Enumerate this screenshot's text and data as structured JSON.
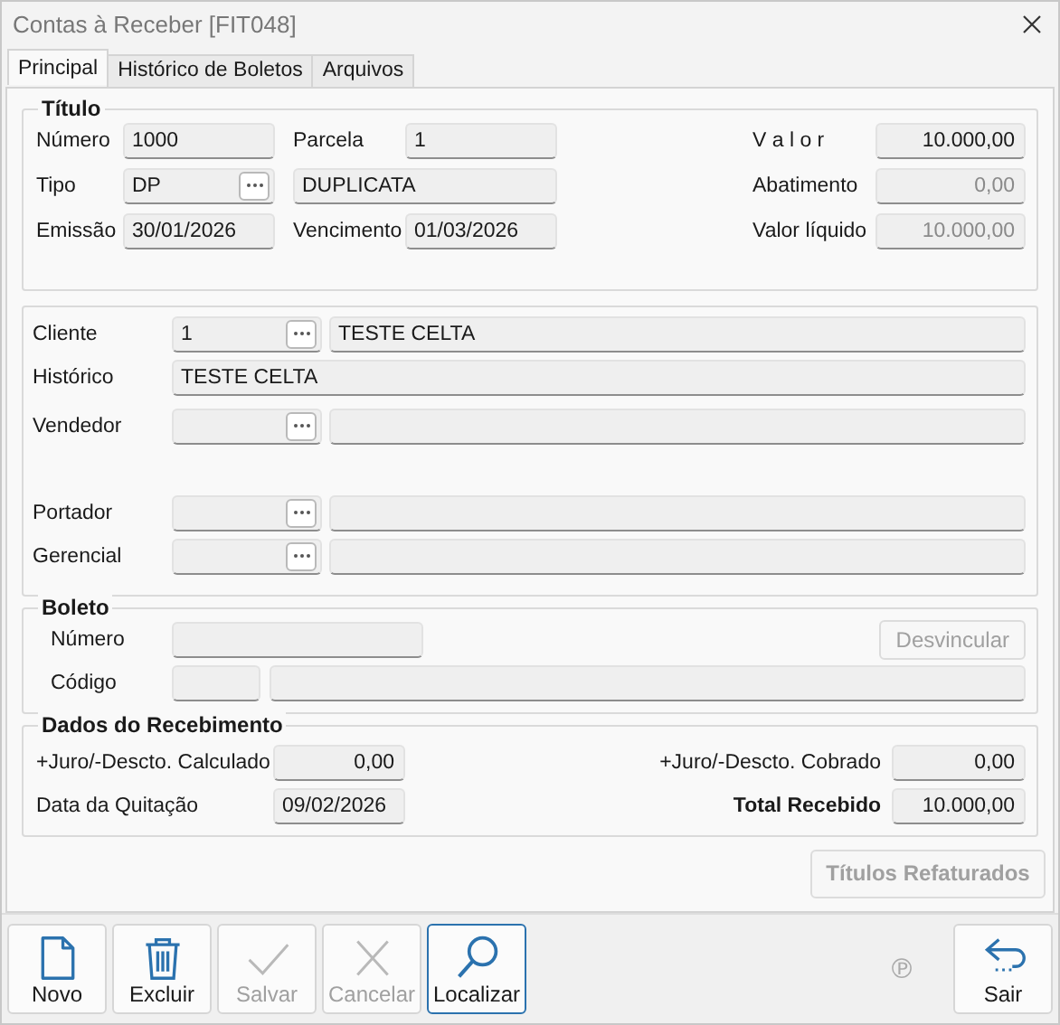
{
  "window": {
    "title": "Contas à Receber [FIT048]"
  },
  "tabs": [
    {
      "label": "Principal",
      "selected": true
    },
    {
      "label": "Histórico de Boletos",
      "selected": false
    },
    {
      "label": "Arquivos",
      "selected": false
    }
  ],
  "titulo": {
    "legend": "Título",
    "rows": [
      {
        "left": {
          "label": "Número",
          "value": "1000",
          "lookup": false
        },
        "mid": {
          "label": "Parcela",
          "value": "1"
        },
        "right": {
          "label": "V a l o r",
          "value": "10.000,00",
          "disabled": false
        }
      },
      {
        "left": {
          "label": "Tipo",
          "value": "DP",
          "lookup": true
        },
        "mid": {
          "value": "DUPLICATA"
        },
        "right": {
          "label": "Abatimento",
          "value": "0,00",
          "disabled": true
        }
      },
      {
        "left": {
          "label": "Emissão",
          "value": "30/01/2026",
          "lookup": false
        },
        "mid": {
          "label": "Vencimento",
          "value": "01/03/2026"
        },
        "right": {
          "label": "Valor líquido",
          "value": "10.000,00",
          "disabled": true
        }
      }
    ]
  },
  "cliente": {
    "rows": [
      {
        "kind": "lookup",
        "label": "Cliente",
        "code": "1",
        "description": "TESTE CELTA"
      },
      {
        "kind": "text",
        "label": "Histórico",
        "value": "TESTE CELTA"
      },
      {
        "kind": "lookup",
        "label": "Vendedor"
      },
      {
        "kind": "lookup",
        "label": "Portador"
      },
      {
        "kind": "lookup",
        "label": "Gerencial"
      }
    ]
  },
  "boleto": {
    "legend": "Boleto",
    "numero_label": "Número",
    "codigo_label": "Código",
    "unlink_button": {
      "label": "Desvincular",
      "disabled": true
    }
  },
  "recebimento": {
    "legend": "Dados do Recebimento",
    "rows": [
      {
        "left": {
          "label": "+Juro/-Descto. Calculado",
          "value": "0,00",
          "kind": "amount"
        },
        "right": {
          "label": "+Juro/-Descto. Cobrado",
          "value": "0,00",
          "bold": false
        }
      },
      {
        "left": {
          "label": "Data da Quitação",
          "value": "09/02/2026",
          "kind": "date"
        },
        "right": {
          "label": "Total Recebido",
          "value": "10.000,00",
          "bold": true
        }
      }
    ]
  },
  "refaturados_button": {
    "label": "Títulos Refaturados",
    "disabled": true
  },
  "toolbar": [
    {
      "kind": "new",
      "label": "Novo",
      "disabled": false,
      "selected": false
    },
    {
      "kind": "delete",
      "label": "Excluir",
      "disabled": false,
      "selected": false
    },
    {
      "kind": "save",
      "label": "Salvar",
      "disabled": true,
      "selected": false
    },
    {
      "kind": "cancel",
      "label": "Cancelar",
      "disabled": true,
      "selected": false
    },
    {
      "kind": "search",
      "label": "Localizar",
      "disabled": false,
      "selected": true
    }
  ],
  "status_mark": "℗",
  "exit_button": {
    "kind": "exit",
    "label": "Sair",
    "disabled": false,
    "selected": false
  }
}
